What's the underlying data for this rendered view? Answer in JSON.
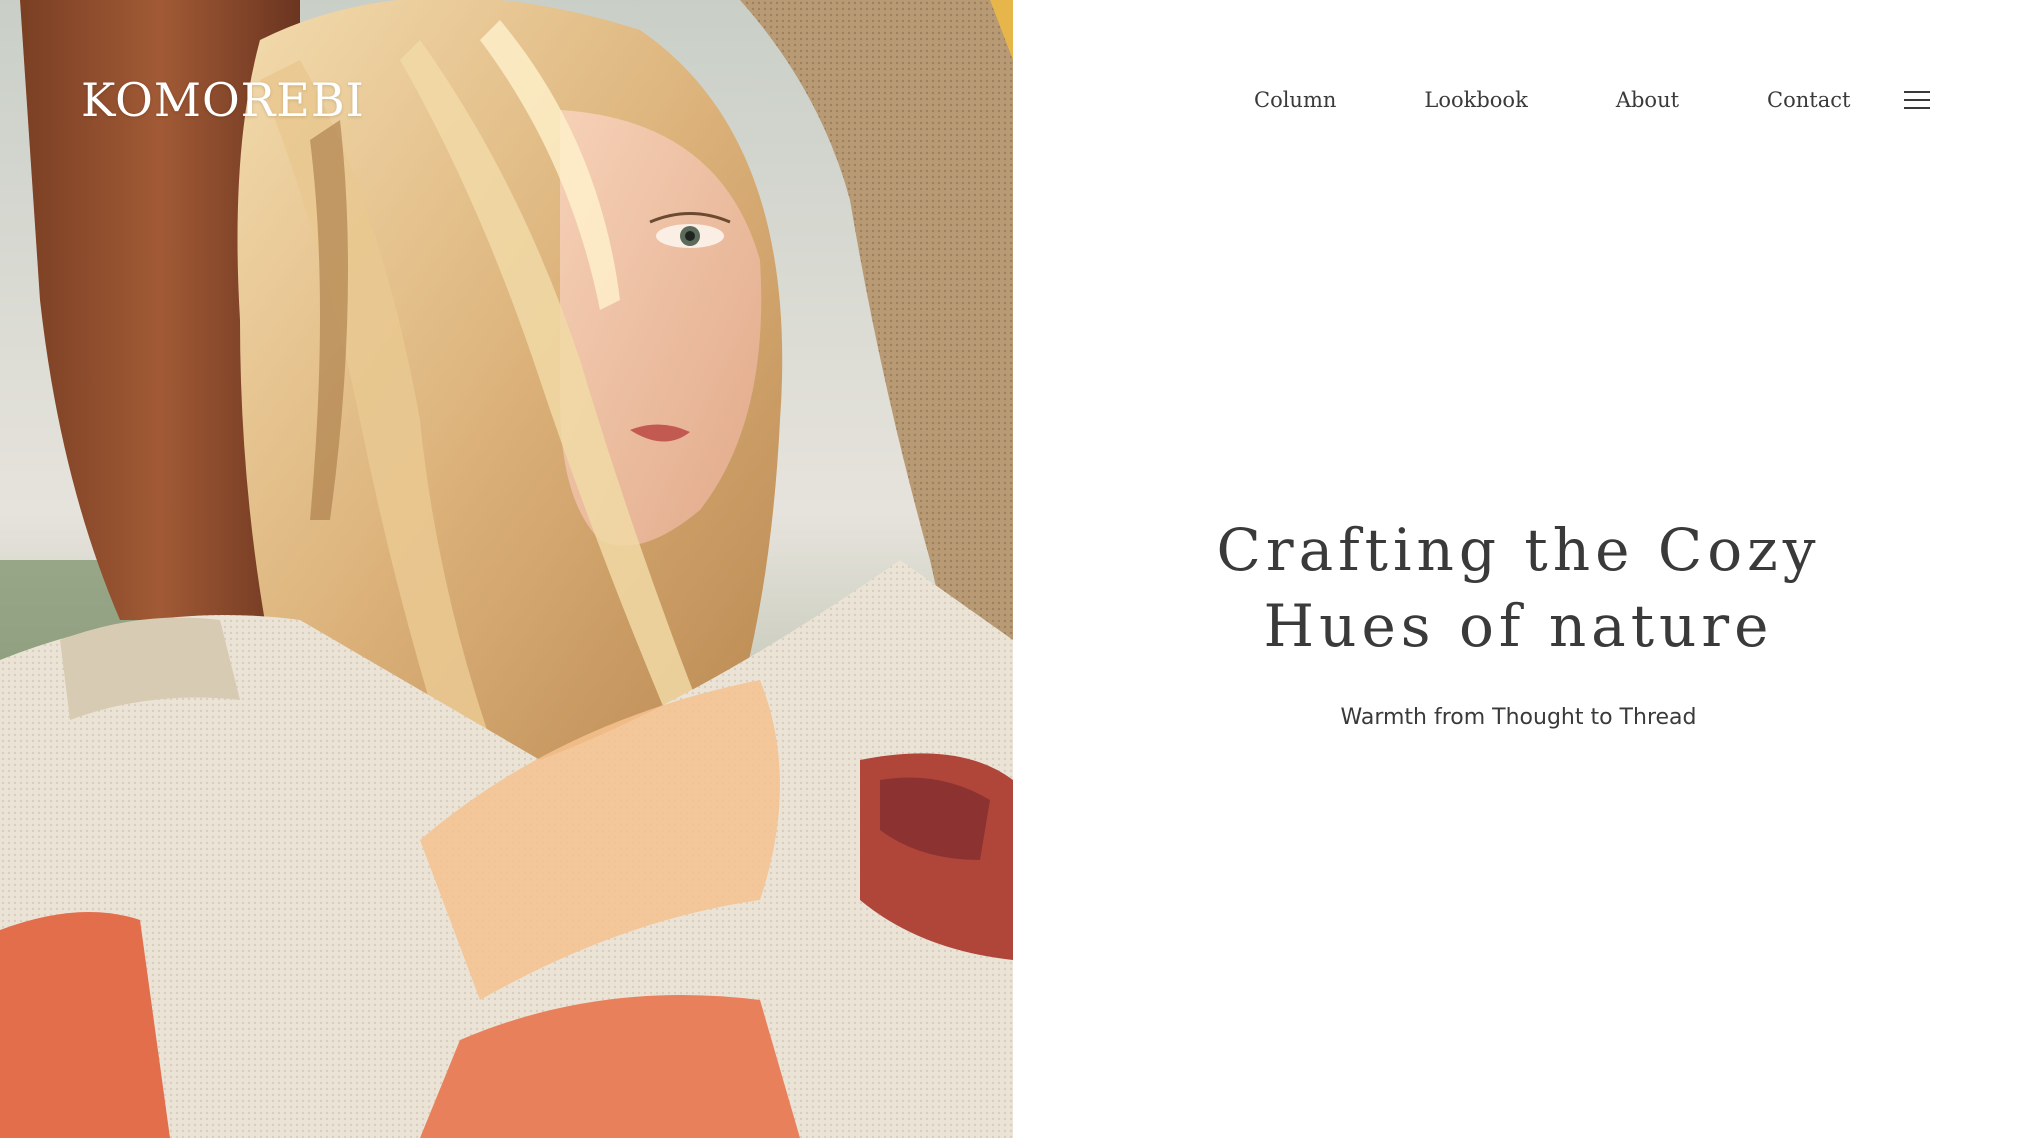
{
  "brand": {
    "logo_text": "KOMOREBI"
  },
  "nav": {
    "items": [
      {
        "label": "Column"
      },
      {
        "label": "Lookbook"
      },
      {
        "label": "About"
      },
      {
        "label": "Contact"
      }
    ],
    "menu_icon": "hamburger-menu-icon"
  },
  "hero": {
    "title_line1": "Crafting the Cozy",
    "title_line2": "Hues of nature",
    "subtitle": "Warmth from Thought to Thread",
    "photo_subject": "woman-in-knit-sweater-photo"
  },
  "colors": {
    "text": "#3a3a3a",
    "background": "#ffffff",
    "logo": "#ffffff"
  }
}
